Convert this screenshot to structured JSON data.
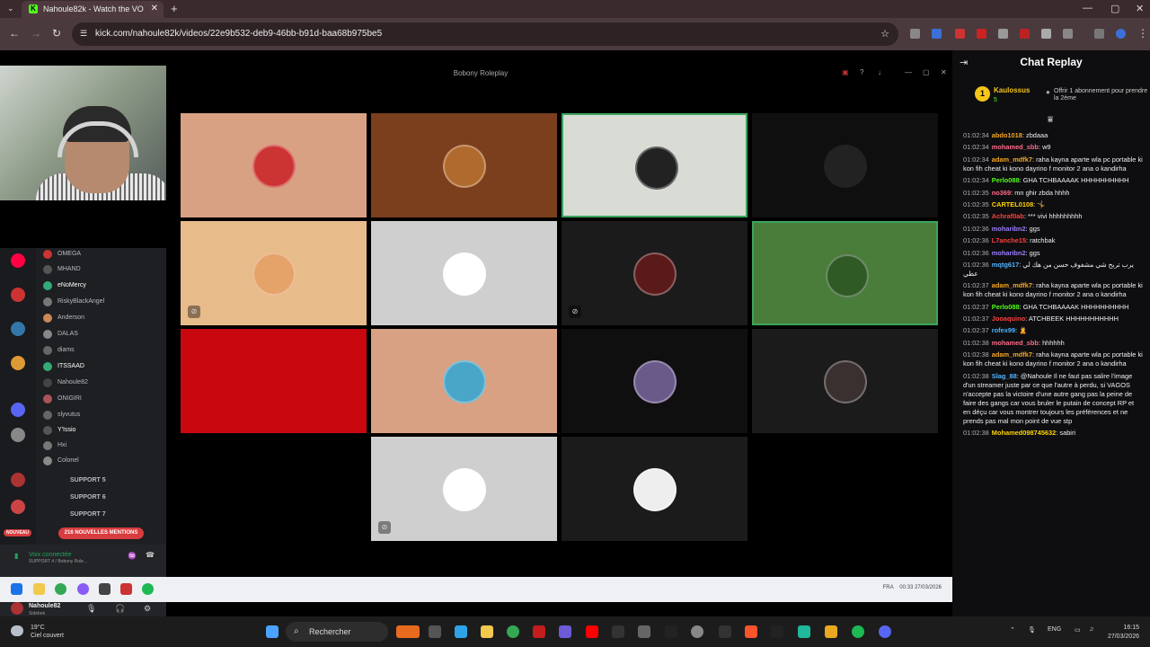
{
  "browser": {
    "tab_title": "Nahoule82k - Watch the VO",
    "tab_favicon": "K",
    "url": "kick.com/nahoule82k/videos/22e9b532-deb9-46bb-b91d-baa68b975be5",
    "accent": "#53fc18"
  },
  "call": {
    "window_title": "Bobony Roleplay"
  },
  "discord": {
    "voice_users": [
      "OMEGA",
      "MHAND",
      "eNoMercy",
      "RiskyBlackAngel",
      "Anderson",
      "DALAS",
      "diams",
      "ITSSAAD",
      "Nahoule82",
      "ONIGIRI",
      "slyvutus",
      "Y'Issio",
      "Hxi",
      "Colonel"
    ],
    "channels": [
      "SUPPORT 5",
      "SUPPORT 6",
      "SUPPORT 7"
    ],
    "mentions_label": "216 NOUVELLES MENTIONS",
    "new_label": "NOUVEAU",
    "voice_status": "Voix connectée",
    "voice_channel": "SUPPORT 4 / Bobony Role...",
    "me_name": "Nahoule82",
    "me_sub": "Sidebek"
  },
  "inner_taskbar": {
    "lang": "FRA",
    "time": "00:33",
    "date": "27/03/2026"
  },
  "chat": {
    "title": "Chat Replay",
    "sub_badge": "1",
    "sub_user": "Kaulossus",
    "sub_count": "5",
    "sub_offer": "Offrir 1 abonnement pour prendre la 2ème",
    "messages": [
      {
        "time": "01:02:34",
        "user": "abdo1018",
        "color": "#f5a623",
        "text": "zbdaaa"
      },
      {
        "time": "01:02:34",
        "user": "mohamed_sbb",
        "color": "#ff6b8a",
        "text": "w9"
      },
      {
        "time": "01:02:34",
        "user": "adam_mdfk7",
        "color": "#f5a623",
        "text": "raha kayna aparte wla pc portable ki kon fih cheat ki kono dayrino f monitor 2 ana o kandirha"
      },
      {
        "time": "01:02:34",
        "user": "Perlo088",
        "color": "#53fc18",
        "text": "GHA TCHBAAAAK HHHHHHHHHH"
      },
      {
        "time": "01:02:35",
        "user": "no369",
        "color": "#ff6b8a",
        "text": "mn ghir zbda hhhh"
      },
      {
        "time": "01:02:35",
        "user": "CARTEL0108",
        "color": "#ffd400",
        "text": "🤸"
      },
      {
        "time": "01:02:35",
        "user": "Achraf0ab",
        "color": "#ff4040",
        "text": "*** vivi hhhhhhhhh"
      },
      {
        "time": "01:02:36",
        "user": "moharibn2",
        "color": "#9b7bff",
        "text": "ggs"
      },
      {
        "time": "01:02:36",
        "user": "L7anche15",
        "color": "#ff4040",
        "text": "ratchbak"
      },
      {
        "time": "01:02:36",
        "user": "moharibn2",
        "color": "#9b7bff",
        "text": "ggs"
      },
      {
        "time": "01:02:36",
        "user": "mqtg617",
        "color": "#4fb4ff",
        "text": "يرب تربح شي مشفوف حسن من هك لي عطي"
      },
      {
        "time": "01:02:37",
        "user": "adam_mdfk7",
        "color": "#f5a623",
        "text": "raha kayna aparte wla pc portable ki kon fih cheat ki kono dayrino f monitor 2 ana o kandirha"
      },
      {
        "time": "01:02:37",
        "user": "Perlo088",
        "color": "#53fc18",
        "text": "GHA TCHBAAAAK HHHHHHHHHH"
      },
      {
        "time": "01:02:37",
        "user": "Jooaquino",
        "color": "#ff4040",
        "text": "ATCHBEEK HHHHHHHHHHH"
      },
      {
        "time": "01:02:37",
        "user": "rofex99",
        "color": "#4fb4ff",
        "text": "🙎"
      },
      {
        "time": "01:02:38",
        "user": "mohamed_sbb",
        "color": "#ff6b8a",
        "text": "hhhhhh"
      },
      {
        "time": "01:02:38",
        "user": "adam_mdfk7",
        "color": "#f5a623",
        "text": "raha kayna aparte wla pc portable ki kon fih cheat ki kono dayrino f monitor 2 ana o kandirha"
      },
      {
        "time": "01:02:38",
        "user": "Slag_88",
        "color": "#4fb4ff",
        "text": "@Nahoule Il ne faut pas salire l'image d'un streamer juste par ce que l'autre à perdu, si VAGOS n'accepte pas la victoire d'une autre gang pas la peine de faire des gangs car vous bruler le putain de concept RP et en déçu car vous montrer toujours les préférences et ne prends pas mal mon point de vue stp"
      },
      {
        "time": "01:02:38",
        "user": "Mohamed098745632",
        "color": "#ffd400",
        "text": "sabiri"
      }
    ]
  },
  "os": {
    "temp": "19°C",
    "weather": "Ciel couvert",
    "search_placeholder": "Rechercher",
    "lang": "ENG",
    "time": "16:15",
    "date": "27/03/2026"
  }
}
